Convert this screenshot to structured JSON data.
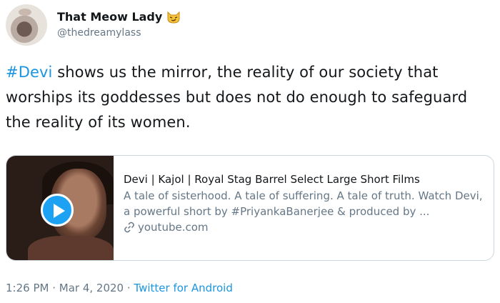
{
  "user": {
    "display_name": "That Meow Lady",
    "handle": "@thedreamylass"
  },
  "tweet": {
    "hashtag": "#Devi",
    "text": " shows us the mirror, the reality of our society that worships its goddesses but does not do enough to safeguard the reality of its women."
  },
  "card": {
    "title": "Devi | Kajol | Royal Stag Barrel Select Large Short Films",
    "description": "A tale of sisterhood. A tale of suffering. A tale of truth. Watch Devi, a powerful short by #PriyankaBanerjee & produced by ...",
    "domain": "youtube.com",
    "icons": [
      "play-icon",
      "link-icon"
    ]
  },
  "footer": {
    "time": "1:26 PM",
    "sep1": " · ",
    "date": "Mar 4, 2020",
    "sep2": " · ",
    "source": "Twitter for Android"
  },
  "colors": {
    "accent": "#1da1f2",
    "link": "#1b95e0",
    "muted": "#657786",
    "text": "#14171a"
  }
}
